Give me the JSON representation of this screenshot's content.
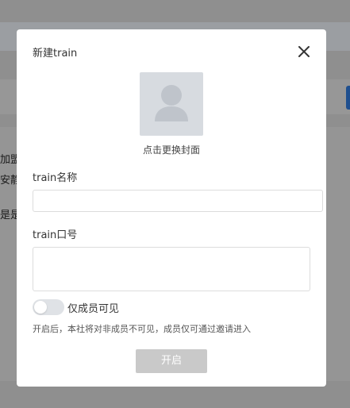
{
  "background": {
    "fragments": [
      "加盟",
      "安静",
      "是是"
    ]
  },
  "dialog": {
    "title": "新建train",
    "close_icon": "close-icon",
    "cover": {
      "icon": "avatar-placeholder-icon",
      "label": "点击更换封面"
    },
    "name_field": {
      "label": "train名称",
      "value": "",
      "placeholder": ""
    },
    "slogan_field": {
      "label": "train口号",
      "value": "",
      "placeholder": ""
    },
    "members_only": {
      "label": "仅成员可见",
      "enabled": false,
      "hint": "开启后，本社将对非成员不可见，成员仅可通过邀请进入"
    },
    "submit_label": "开启"
  },
  "colors": {
    "overlay": "#8f8f8f",
    "cover_bg": "#d7dbe0",
    "avatar_fill": "#bfc4cb",
    "button_disabled": "#c9c9c9",
    "toggle_off": "#dfe2e6"
  }
}
